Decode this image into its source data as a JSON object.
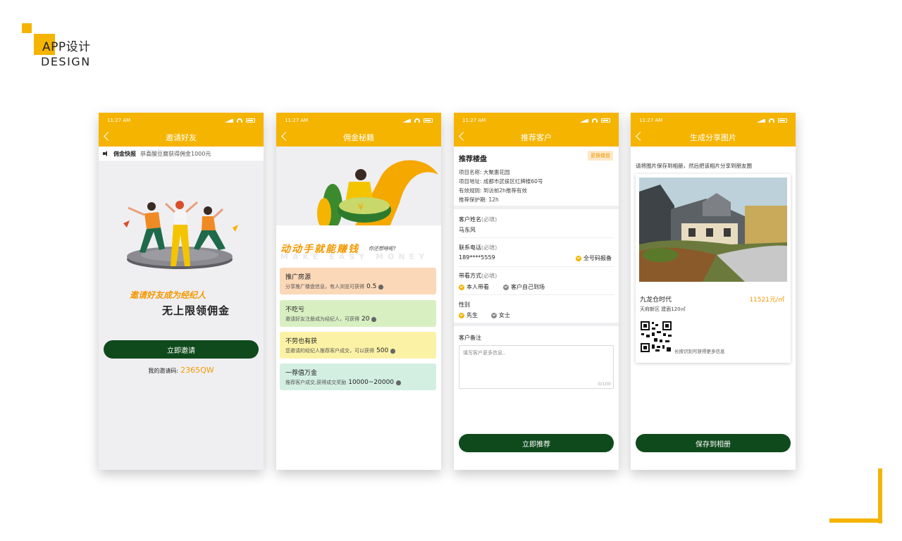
{
  "brand": {
    "title": "APP设计",
    "subtitle": "DESIGN"
  },
  "colors": {
    "accent": "#f5b400",
    "orange_text": "#f39800",
    "button_green": "#0f4a1c"
  },
  "status_time": "11:27 AM",
  "phone1": {
    "nav_title": "邀请好友",
    "ticker_label": "佣金快报",
    "ticker_text": "恭喜酸豆腐获得佣金1000元",
    "slogan_line1": "邀请好友成为经纪人",
    "slogan_line2": "无上限领佣金",
    "invite_button": "立即邀请",
    "invite_code_label": "我的邀请码:",
    "invite_code": "2365QW"
  },
  "phone2": {
    "nav_title": "佣金秘籍",
    "headline": "动动手就能赚钱",
    "sub_headline": "你还想啥呢?",
    "ghost_text": "MAKE EASY MONEY",
    "cards": [
      {
        "title": "推广房源",
        "desc": "分享推广楼盘信息，有人浏览可获得",
        "amount": "0.5"
      },
      {
        "title": "不吃亏",
        "desc": "邀请好友注册成为经纪人，可获得",
        "amount": "20"
      },
      {
        "title": "不劳也有获",
        "desc": "您邀请的经纪人推荐客户成交，可以获得",
        "amount": "500"
      },
      {
        "title": "一荐值万金",
        "desc": "推荐客户成交,获得成交奖励",
        "amount": "10000~20000"
      }
    ]
  },
  "phone3": {
    "nav_title": "推荐客户",
    "section_title": "推荐楼盘",
    "change_tag": "更换楼盘",
    "project_name": "项目名称: 大聚惠花园",
    "project_address": "项目地址: 成都市武侯区红牌楼60号",
    "rule": "有效规则: 到访前2h推荐有效",
    "protect": "推荐保护期: 12h",
    "name_label": "客户姓名",
    "phone_label": "联系电话",
    "visit_label": "带看方式",
    "gender_label": "性别",
    "required": "(必填)",
    "name_value": "马东风",
    "phone_value": "189****5559",
    "full_number_option": "全号码报备",
    "visit_options": [
      "本人带看",
      "客户自己到场"
    ],
    "gender_options": [
      "先生",
      "女士"
    ],
    "remark_label": "客户备注",
    "remark_placeholder": "填写客户更多信息..",
    "remark_counter": "0/100",
    "submit_button": "立即推荐"
  },
  "phone4": {
    "nav_title": "生成分享图片",
    "hint": "请将图片保存到相册，然后把该相片分享到朋友圈",
    "house_name": "九龙仓时代",
    "price": "11521元/㎡",
    "house_meta": "天府新区    建面120㎡",
    "qr_hint": "长按识别可获得更多信息",
    "save_button": "保存到相册"
  }
}
